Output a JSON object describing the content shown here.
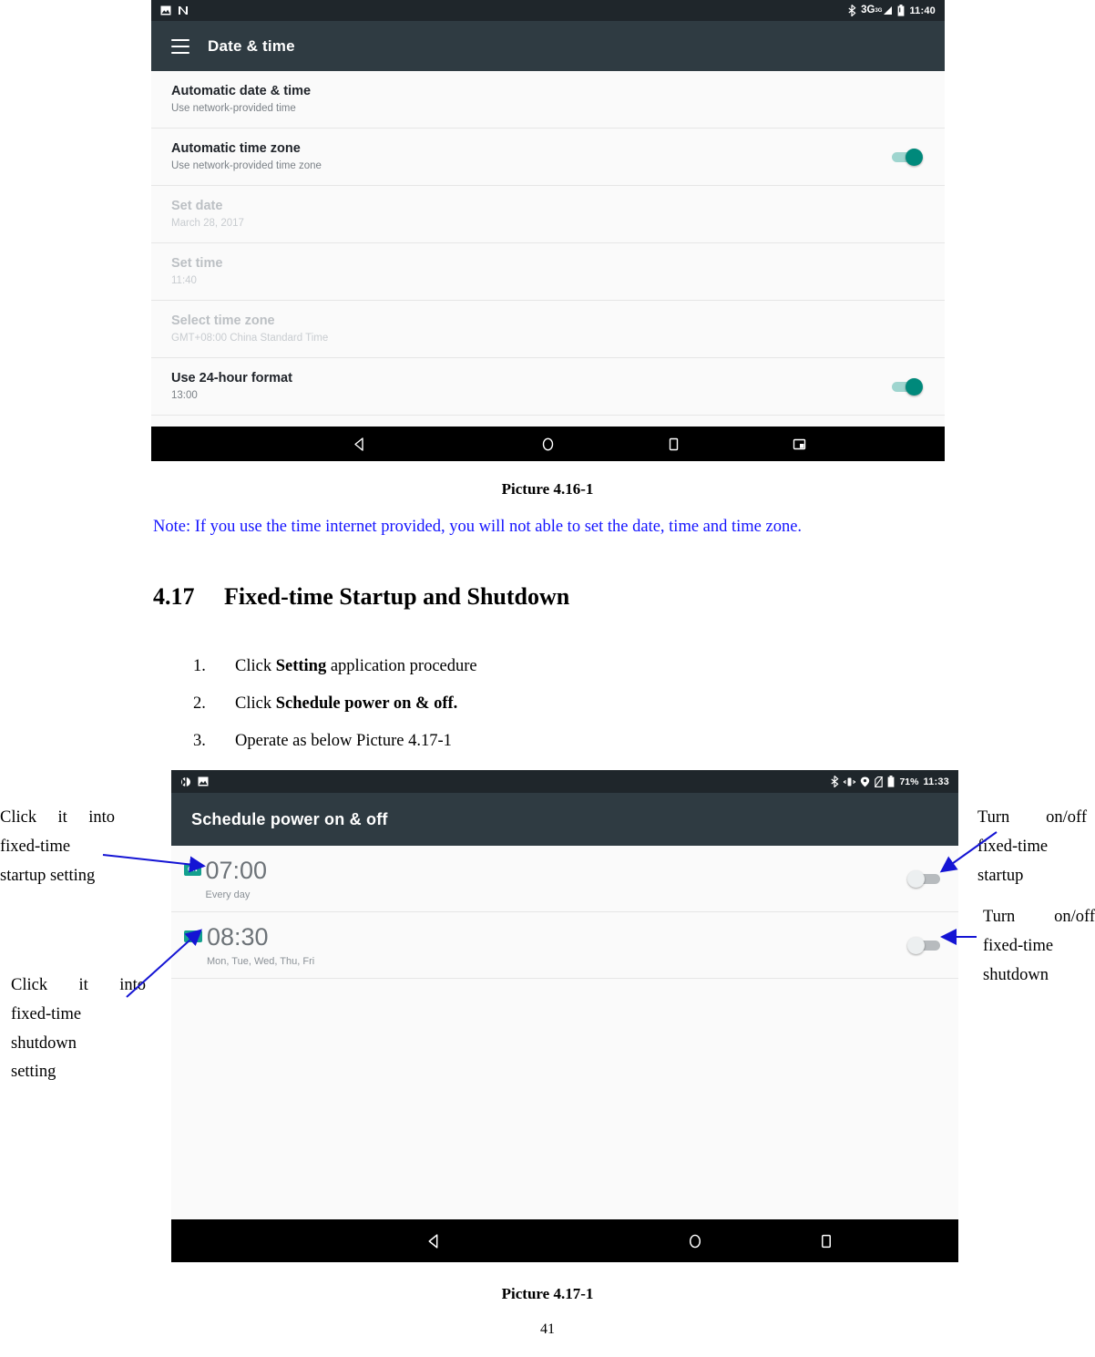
{
  "colors": {
    "statusbar_bg": "#1f262b",
    "appbar_bg": "#2f3b42",
    "toggle_on": "#00897b",
    "toggle_on_track": "#9fd5cf",
    "badge": "#13a08e",
    "note_blue": "#1414ff",
    "arrow_blue": "#1414d4"
  },
  "screenshot1": {
    "statusbar": {
      "left_icons": [
        "image-icon",
        "nfc-icon"
      ],
      "right_icons": [
        "bluetooth-icon",
        "signal-3g-icon",
        "battery-icon"
      ],
      "network_label": "3G",
      "clock": "11:40"
    },
    "appbar": {
      "menu_icon": "hamburger-icon",
      "title": "Date & time"
    },
    "rows": [
      {
        "title": "Automatic date & time",
        "subtitle": "Use network-provided time",
        "toggle": null,
        "disabled": false
      },
      {
        "title": "Automatic time zone",
        "subtitle": "Use network-provided time zone",
        "toggle": "on",
        "disabled": false
      },
      {
        "title": "Set date",
        "subtitle": "March 28, 2017",
        "toggle": null,
        "disabled": true
      },
      {
        "title": "Set time",
        "subtitle": "11:40",
        "toggle": null,
        "disabled": true
      },
      {
        "title": "Select time zone",
        "subtitle": "GMT+08:00 China Standard Time",
        "toggle": null,
        "disabled": true
      },
      {
        "title": "Use 24-hour format",
        "subtitle": "13:00",
        "toggle": "on",
        "disabled": false
      }
    ],
    "navbar": [
      "back-icon",
      "home-icon",
      "recents-icon",
      "screenshot-icon"
    ]
  },
  "caption1": "Picture 4.16-1",
  "note": "Note: If you use the time internet provided, you will not able to set the date, time and time zone.",
  "heading": {
    "number": "4.17",
    "text": "Fixed-time Startup and Shutdown"
  },
  "steps": [
    {
      "idx": "1.",
      "pre": "Click ",
      "bold": "Setting",
      "post": " application procedure"
    },
    {
      "idx": "2.",
      "pre": "Click ",
      "bold": "Schedule power on & off.",
      "post": ""
    },
    {
      "idx": "3.",
      "pre": "Operate as below Picture 4.17-1",
      "bold": "",
      "post": ""
    }
  ],
  "screenshot2": {
    "statusbar": {
      "left_icons": [
        "sync-icon",
        "image-icon"
      ],
      "right_icons": [
        "bluetooth-icon",
        "vibrate-icon",
        "location-icon",
        "no-sim-icon",
        "battery-icon"
      ],
      "battery_pct": "71%",
      "clock": "11:33"
    },
    "appbar": {
      "title": "Schedule power on & off"
    },
    "alarms": [
      {
        "badge": "ON",
        "time": "07:00",
        "days": "Every day",
        "toggle": "off"
      },
      {
        "badge": "OFF",
        "time": "08:30",
        "days": "Mon, Tue, Wed, Thu, Fri",
        "toggle": "off"
      }
    ],
    "navbar": [
      "back-icon",
      "home-icon",
      "recents-icon"
    ]
  },
  "annotations": {
    "left_top": [
      "Click",
      "it",
      "into",
      "fixed-time",
      "startup setting"
    ],
    "left_top_lines": [
      [
        "Click",
        "it",
        "into"
      ],
      [
        "fixed-time"
      ],
      [
        "startup setting"
      ]
    ],
    "left_bottom_lines": [
      [
        "Click",
        "it",
        "into"
      ],
      [
        "fixed-time"
      ],
      [
        "shutdown"
      ],
      [
        "setting"
      ]
    ],
    "right_top_lines": [
      [
        "Turn",
        "on/off"
      ],
      [
        "fixed-time"
      ],
      [
        "startup"
      ]
    ],
    "right_bottom_lines": [
      [
        "Turn",
        "on/off"
      ],
      [
        "fixed-time"
      ],
      [
        "shutdown"
      ]
    ]
  },
  "caption2": "Picture 4.17-1",
  "page_number": "41"
}
